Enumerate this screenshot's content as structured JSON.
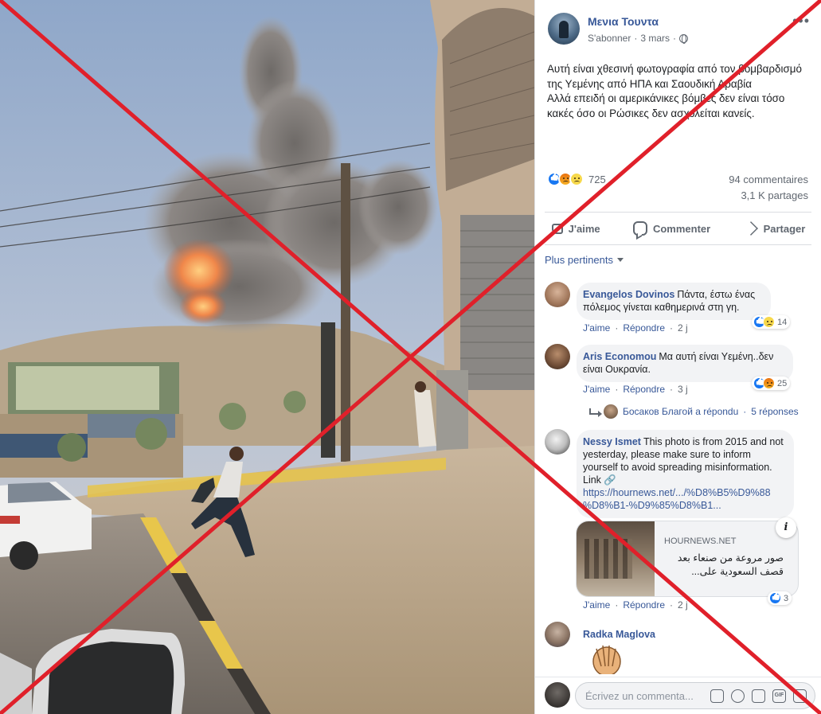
{
  "post": {
    "author": "Μενια Τουντα",
    "meta_follow": "S'abonner",
    "meta_date": "3 mars",
    "meta_dot": "·",
    "text_lines": [
      "Αυτή είναι χθεσινή φωτογραφία από τον βομβαρδισμό της Υεμένης από ΗΠΑ και Σαουδική Αραβία",
      "Αλλά επειδή οι αμερικάνικες βόμβες δεν είναι τόσο κακές όσο οι Ρώσικες δεν ασχολείται κανείς."
    ],
    "reaction_count": "725",
    "comments_count": "94 commentaires",
    "shares_count": "3,1 K partages"
  },
  "actions": {
    "like": "J'aime",
    "comment": "Commenter",
    "share": "Partager"
  },
  "sort_label": "Plus pertinents",
  "comments": [
    {
      "name": "Evangelos Dovinos",
      "text": "Πάντα, έστω ένας πόλεμος γίνεται καθημερινά στη γη.",
      "like": "J'aime",
      "reply": "Répondre",
      "time": "2 j",
      "reactions": "14"
    },
    {
      "name": "Aris Economou",
      "text": "Μα αυτή είναι Υεμένη..δεν είναι Ουκρανία.",
      "like": "J'aime",
      "reply": "Répondre",
      "time": "3 j",
      "reactions": "25"
    },
    {
      "name": "Nessy Ismet",
      "text": "This photo is from 2015 and not yesterday, please make sure to inform yourself to avoid spreading misinformation. Link 🔗",
      "link_line1": "https://hournews.net/.../%D8%B5%D9%88",
      "link_line2": "%D8%B1-%D9%85%D8%B1...",
      "like": "J'aime",
      "reply": "Répondre",
      "time": "2 j",
      "reactions": "3"
    },
    {
      "name": "Radka Maglova"
    }
  ],
  "reply_summary": {
    "who": "Босаков Благой a répondu",
    "sep": "·",
    "count": "5 réponses"
  },
  "link_card": {
    "domain": "HOURNEWS.NET",
    "title": "صور مروعة من صنعاء بعد قصف السعودية علی..."
  },
  "composer": {
    "placeholder": "Écrivez un commenta...",
    "gif_label": "GIF"
  },
  "colors": {
    "link_blue": "#385898",
    "fb_blue": "#1877f2",
    "bubble_grey": "#f2f3f5",
    "cross_red": "#e0202a"
  }
}
